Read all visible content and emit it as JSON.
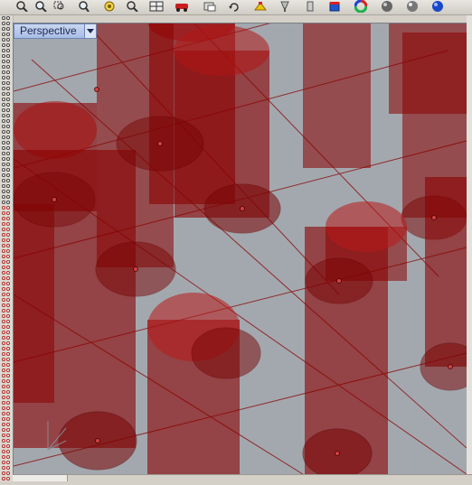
{
  "viewport": {
    "title": "Perspective",
    "dropdown_icon": "chevron-down-icon"
  },
  "toolbar": {
    "icons": [
      "pan-icon",
      "zoom-icon",
      "zoom-window-icon",
      "zoom-extents-icon",
      "zoom-selected-icon",
      "zoom-target-icon",
      "four-viewports-icon",
      "car-icon",
      "named-view-icon",
      "rotate-view-icon",
      "set-cplane-icon",
      "lamp-icon",
      "layer-icon",
      "render-icon",
      "color-wheel-icon",
      "shaded-sphere-icon",
      "rendered-sphere-icon",
      "ghosted-sphere-icon"
    ]
  },
  "colors": {
    "background": "#a3a8ae",
    "grid": "#8a1515",
    "cylinder": "#8b0000",
    "tab": "#b8c8ea"
  }
}
